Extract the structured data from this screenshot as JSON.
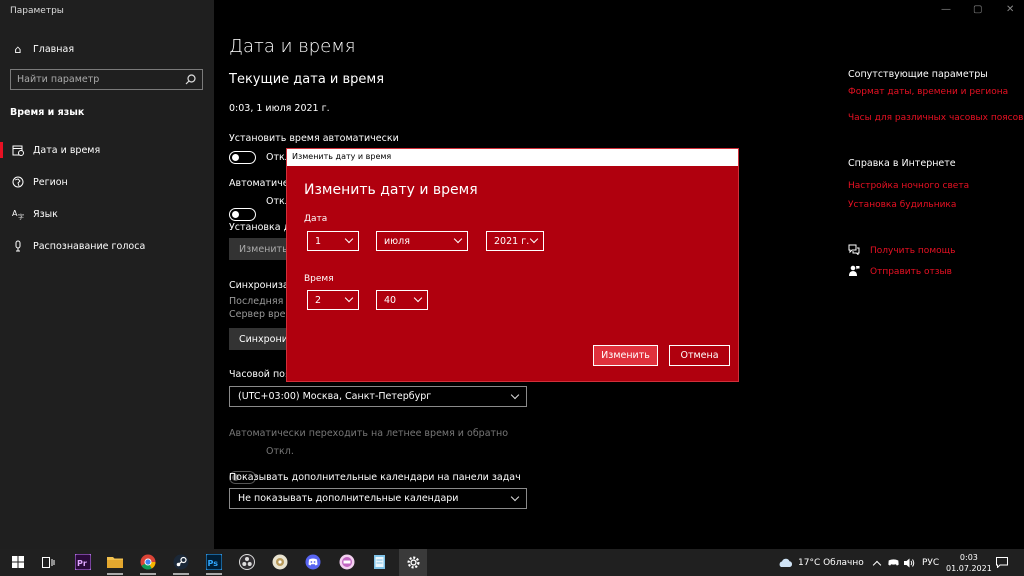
{
  "app": {
    "title": "Параметры",
    "window_controls": [
      "—",
      "▢",
      "✕"
    ]
  },
  "sidebar": {
    "home_label": "Главная",
    "search_placeholder": "Найти параметр",
    "section_label": "Время и язык",
    "items": [
      {
        "label": "Дата и время",
        "icon": "calendar-clock-icon"
      },
      {
        "label": "Регион",
        "icon": "globe-icon"
      },
      {
        "label": "Язык",
        "icon": "language-icon"
      },
      {
        "label": "Распознавание голоса",
        "icon": "microphone-icon"
      }
    ]
  },
  "main": {
    "title": "Дата и время",
    "subtitle": "Текущие дата и время",
    "current_datetime": "0:03, 1 июля 2021 г.",
    "auto_time_label": "Установить время автоматически",
    "auto_time_state": "Откл",
    "auto_zone_label": "Автоматически",
    "auto_zone_state": "Откл",
    "set_manual_label": "Установка да",
    "change_button": "Изменить",
    "sync_label": "Синхронизац",
    "sync_last": "Последняя у",
    "sync_server": "Сервер врем",
    "sync_button": "Синхрониз",
    "timezone_label": "Часовой поя",
    "timezone_value": "(UTC+03:00) Москва, Санкт-Петербург",
    "dst_label": "Автоматически переходить на летнее время и обратно",
    "dst_state": "Откл.",
    "calendars_label": "Показывать дополнительные календари на панели задач",
    "calendars_value": "Не показывать дополнительные календари"
  },
  "right": {
    "related_heading": "Сопутствующие параметры",
    "related_links": [
      "Формат даты, времени и региона",
      "Часы для различных часовых поясов"
    ],
    "help_heading": "Справка в Интернете",
    "help_links": [
      "Настройка ночного света",
      "Установка будильника"
    ],
    "get_help": "Получить помощь",
    "feedback": "Отправить отзыв"
  },
  "dialog": {
    "window_title": "Изменить дату и время",
    "heading": "Изменить дату и время",
    "date_label": "Дата",
    "day": "1",
    "month": "июля",
    "year": "2021 г.",
    "time_label": "Время",
    "hour": "2",
    "minute": "40",
    "ok_button": "Изменить",
    "cancel_button": "Отмена"
  },
  "taskbar": {
    "weather": "17°C  Облачно",
    "lang": "РУС",
    "time": "0:03",
    "date": "01.07.2021"
  },
  "colors": {
    "accent": "#e81123",
    "dialog_bg": "#b0000e",
    "sidebar_bg": "#1f1f1f",
    "taskbar_bg": "#202020"
  }
}
